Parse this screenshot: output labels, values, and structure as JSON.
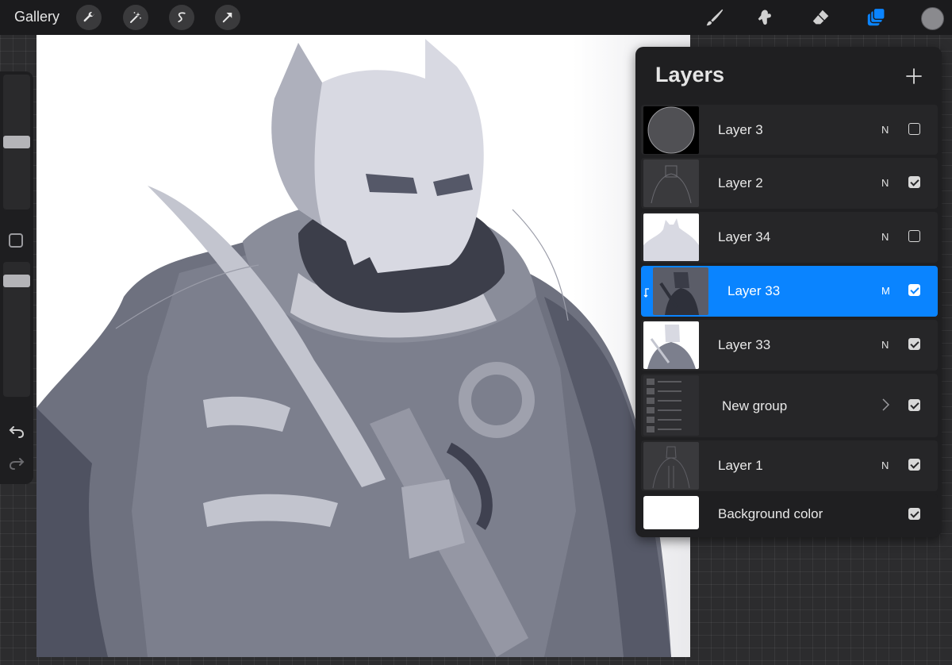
{
  "topbar": {
    "gallery_label": "Gallery",
    "tools_left": [
      "wrench-icon",
      "magic-wand-icon",
      "selection-icon",
      "transform-arrow-icon"
    ],
    "tools_right": [
      "brush-icon",
      "smudge-icon",
      "eraser-icon",
      "layers-icon"
    ],
    "active_tool": "layers-icon",
    "current_color": "#8a8a8e"
  },
  "colors": {
    "accent": "#0a84ff",
    "panel_bg": "#1f1f21",
    "toolbar_bg": "#1b1b1d"
  },
  "layers_panel": {
    "title": "Layers",
    "add_icon": "plus-icon",
    "layers": [
      {
        "name": "Layer 3",
        "mode": "N",
        "visible": false,
        "selected": false,
        "thumb": "dark-circle"
      },
      {
        "name": "Layer 2",
        "mode": "N",
        "visible": true,
        "selected": false,
        "thumb": "sketch"
      },
      {
        "name": "Layer 34",
        "mode": "N",
        "visible": false,
        "selected": false,
        "thumb": "light-silhouette"
      },
      {
        "name": "Layer 33",
        "mode": "M",
        "visible": true,
        "selected": true,
        "clipped": true,
        "thumb": "dark-figure"
      },
      {
        "name": "Layer 33",
        "mode": "N",
        "visible": true,
        "selected": false,
        "thumb": "figure"
      },
      {
        "name": "New group",
        "mode": "",
        "visible": true,
        "selected": false,
        "is_group": true,
        "thumb": "group-list"
      },
      {
        "name": "Layer 1",
        "mode": "N",
        "visible": true,
        "selected": false,
        "thumb": "sketch"
      },
      {
        "name": "Background color",
        "mode": "",
        "visible": true,
        "selected": false,
        "thumb": "white"
      }
    ]
  },
  "sidebar": {
    "brush_size_level": 0.52,
    "opacity_level": 0.95,
    "modify_icon": "square-icon",
    "undo_icon": "undo-icon",
    "redo_icon": "redo-icon"
  }
}
